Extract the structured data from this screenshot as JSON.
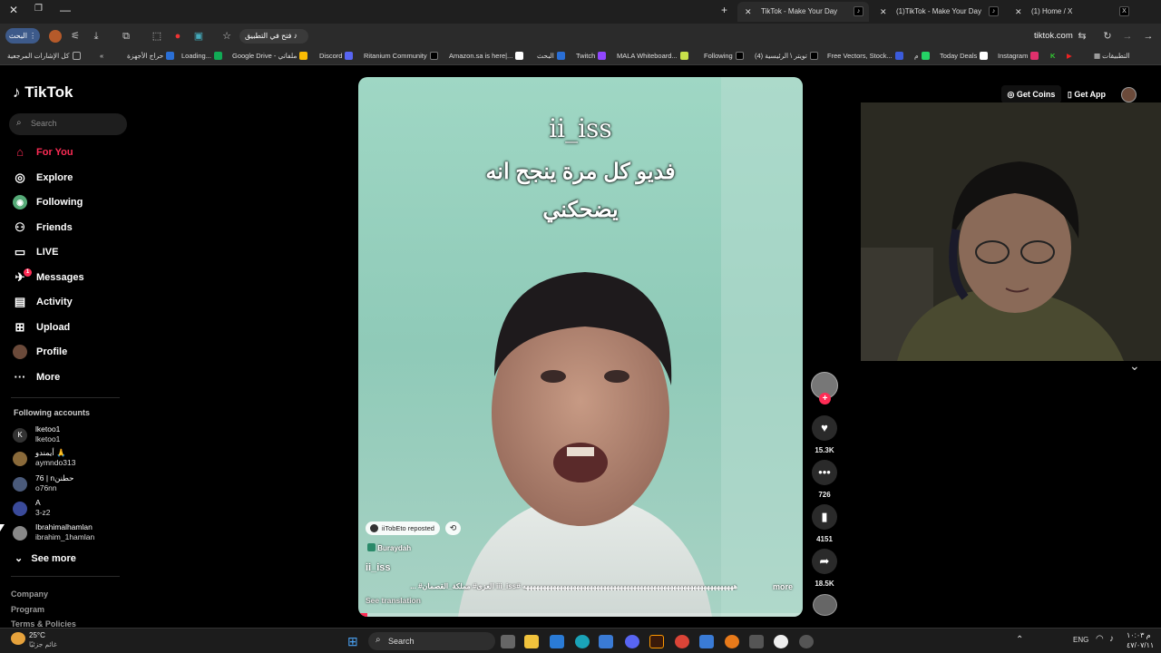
{
  "browser": {
    "tabs": [
      {
        "title": "TikTok - Make Your Day",
        "active": true
      },
      {
        "title": "(1)TikTok - Make Your Day",
        "active": false
      },
      {
        "title": "(1) Home / X",
        "active": false
      }
    ],
    "search_label": "البحث",
    "address": "tiktok.com",
    "open_in_app": "فتح في التطبيق",
    "bookmarks_left": "كل الإشارات المرجعية",
    "apps_label": "التطبيقات",
    "bookmarks": [
      "حراج الأجهزة",
      "Loading...",
      "Google Drive - ملفاتي",
      "Discord",
      "Ritanium Community",
      "Amazon.sa is here|...",
      "البحث",
      "Twitch",
      "MALA Whiteboard...",
      "Following",
      "(4) تويتر \\ الرئيسية",
      "Free Vectors, Stock...",
      "م",
      "Today Deals",
      "Instagram"
    ]
  },
  "sidebar": {
    "logo": "TikTok",
    "search_placeholder": "Search",
    "nav": [
      {
        "label": "For You",
        "icon": "home-icon",
        "active": true
      },
      {
        "label": "Explore",
        "icon": "compass-icon"
      },
      {
        "label": "Following",
        "icon": "following-icon"
      },
      {
        "label": "Friends",
        "icon": "friends-icon"
      },
      {
        "label": "LIVE",
        "icon": "live-icon"
      },
      {
        "label": "Messages",
        "icon": "messages-icon",
        "badge": "1"
      },
      {
        "label": "Activity",
        "icon": "activity-icon"
      },
      {
        "label": "Upload",
        "icon": "upload-icon"
      },
      {
        "label": "Profile",
        "icon": "profile-icon"
      },
      {
        "label": "More",
        "icon": "more-icon"
      }
    ],
    "following_title": "Following accounts",
    "accounts": [
      {
        "name": "lketoo1",
        "handle": "lketoo1"
      },
      {
        "name": "أيمندو 🙏",
        "handle": "aymndo313"
      },
      {
        "name": "76 | nحطنن",
        "handle": "o76nn"
      },
      {
        "name": "A",
        "handle": "3-z2"
      },
      {
        "name": "Ibrahimalhamlan",
        "handle": "ibrahim_1hamlan"
      }
    ],
    "see_more": "See more",
    "footer": [
      "Company",
      "Program",
      "Terms & Policies"
    ]
  },
  "header": {
    "get_coins": "Get Coins",
    "get_app": "Get App"
  },
  "video": {
    "overlay_title": "ii_iss",
    "overlay_text_1": "فديو كل مرة ينجح انه",
    "overlay_text_2": "يضحكني",
    "reposted": "iiTobEto reposted",
    "location": "Buraydah",
    "author": "ii_iss",
    "caption": "هههههههههههههههههههههههههههههههههههههههههههههههههههههههههههههههه #iii_iss العزى# مملكة_القصمان# ...",
    "more": "more",
    "see_translation": "See translation",
    "progress": 0.02
  },
  "actions": {
    "likes": "15.3K",
    "comments": "726",
    "saves": "4151",
    "shares": "18.5K"
  },
  "taskbar": {
    "weather_temp": "25°C",
    "weather_desc": "غائم جزئيًا",
    "search": "Search",
    "lang": "ENG",
    "time": "م ١٠:٠٣",
    "date": "٤٧/٠٧/١١"
  }
}
